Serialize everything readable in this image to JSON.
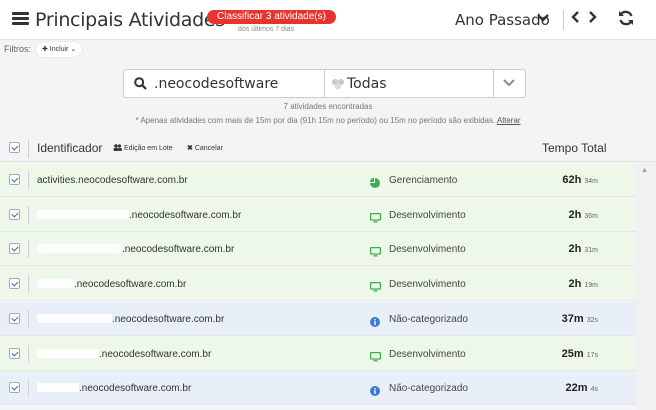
{
  "header": {
    "title": "Principais Atividades",
    "classify_badge": "Classificar 3 atividade(s)",
    "classify_sub": "dos últimos 7 dias",
    "period": "Ano Passado",
    "period_icon": "chevron-down-icon",
    "prev_icon": "chevron-left-icon",
    "next_icon": "chevron-right-icon",
    "refresh_icon": "refresh-icon"
  },
  "filters": {
    "label": "Filtros:",
    "add_button": "✚ Incluir ⌄"
  },
  "search": {
    "query": ".neocodesoftware",
    "category": "Todas"
  },
  "summary": {
    "count": "7",
    "found_text": "atividades encontradas",
    "note": "* Apenas atividades com mais de 15m por dia (91h 15m no período) ou 15m no período são exibidas.",
    "alter_link": "Alterar"
  },
  "table": {
    "col_identifier": "Identificador",
    "bulk_edit": "Edição em Lote",
    "cancel": "Cancelar",
    "col_total": "Tempo Total",
    "rows": [
      {
        "prefix": "activities",
        "mask": 0,
        "domain": ".neocodesoftware.com.br",
        "category": "Gerenciamento",
        "cat_icon": "pie-chart-icon",
        "time_main": "62h",
        "time_sub": "34m",
        "tone": "green"
      },
      {
        "prefix": "",
        "mask": 92,
        "domain": ".neocodesoftware.com.br",
        "category": "Desenvolvimento",
        "cat_icon": "monitor-icon",
        "time_main": "2h",
        "time_sub": "36m",
        "tone": "green"
      },
      {
        "prefix": "",
        "mask": 85,
        "domain": ".neocodesoftware.com.br",
        "category": "Desenvolvimento",
        "cat_icon": "monitor-icon",
        "time_main": "2h",
        "time_sub": "31m",
        "tone": "green"
      },
      {
        "prefix": "",
        "mask": 37,
        "domain": ".neocodesoftware.com.br",
        "category": "Desenvolvimento",
        "cat_icon": "monitor-icon",
        "time_main": "2h",
        "time_sub": "19m",
        "tone": "green"
      },
      {
        "prefix": "",
        "mask": 75,
        "domain": ".neocodesoftware.com.br",
        "category": "Não-categorizado",
        "cat_icon": "info-icon",
        "time_main": "37m",
        "time_sub": "32s",
        "tone": "blue"
      },
      {
        "prefix": "",
        "mask": 62,
        "domain": ".neocodesoftware.com.br",
        "category": "Desenvolvimento",
        "cat_icon": "monitor-icon",
        "time_main": "25m",
        "time_sub": "17s",
        "tone": "green"
      },
      {
        "prefix": "",
        "mask": 42,
        "domain": ".neocodesoftware.com.br",
        "category": "Não-categorizado",
        "cat_icon": "info-icon",
        "time_main": "22m",
        "time_sub": "4s",
        "tone": "blue"
      }
    ]
  },
  "colors": {
    "badge": "#e8342e",
    "green_row": "#edf8eb",
    "blue_row": "#e9eff8",
    "category_green": "#3cb04a",
    "category_blue": "#3b7bd8"
  }
}
